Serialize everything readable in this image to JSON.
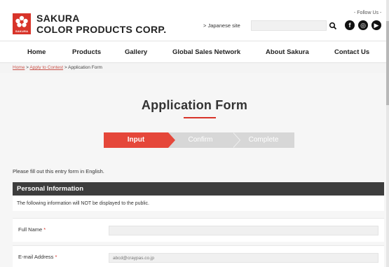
{
  "header": {
    "logo_tag": "SAKURA",
    "brand_line1": "SAKURA",
    "brand_line2": "COLOR PRODUCTS CORP.",
    "japanese_site": "> Japanese site",
    "search_placeholder": "",
    "follow_us": "- Follow Us -",
    "social": [
      {
        "name": "facebook-icon",
        "glyph": "f"
      },
      {
        "name": "instagram-icon",
        "glyph": "◎"
      },
      {
        "name": "youtube-icon",
        "glyph": "▶"
      }
    ]
  },
  "nav": {
    "items": [
      "Home",
      "Products",
      "Gallery",
      "Global Sales Network",
      "About Sakura",
      "Contact Us"
    ]
  },
  "breadcrumb": {
    "home": "Home",
    "sep1": " > ",
    "apply": "Apply to Contest",
    "sep2": " > ",
    "current": "Application Form"
  },
  "page": {
    "title": "Application Form"
  },
  "steps": {
    "input": "Input",
    "confirm": "Confirm",
    "complete": "Complete"
  },
  "form": {
    "intro": "Please fill out this entry form in English.",
    "section_title": "Personal Information",
    "notice": "The following information will NOT be displayed to the public.",
    "full_name_label": "Full Name",
    "full_name_value": "",
    "email_label": "E-mail Address",
    "email_placeholder": "abcd@craypas.co.jp",
    "required_mark": "*"
  },
  "colors": {
    "accent": "#d8342a",
    "step_active": "#e5473a",
    "step_inactive": "#d7d7d7",
    "section_bg": "#3d3d3d"
  }
}
